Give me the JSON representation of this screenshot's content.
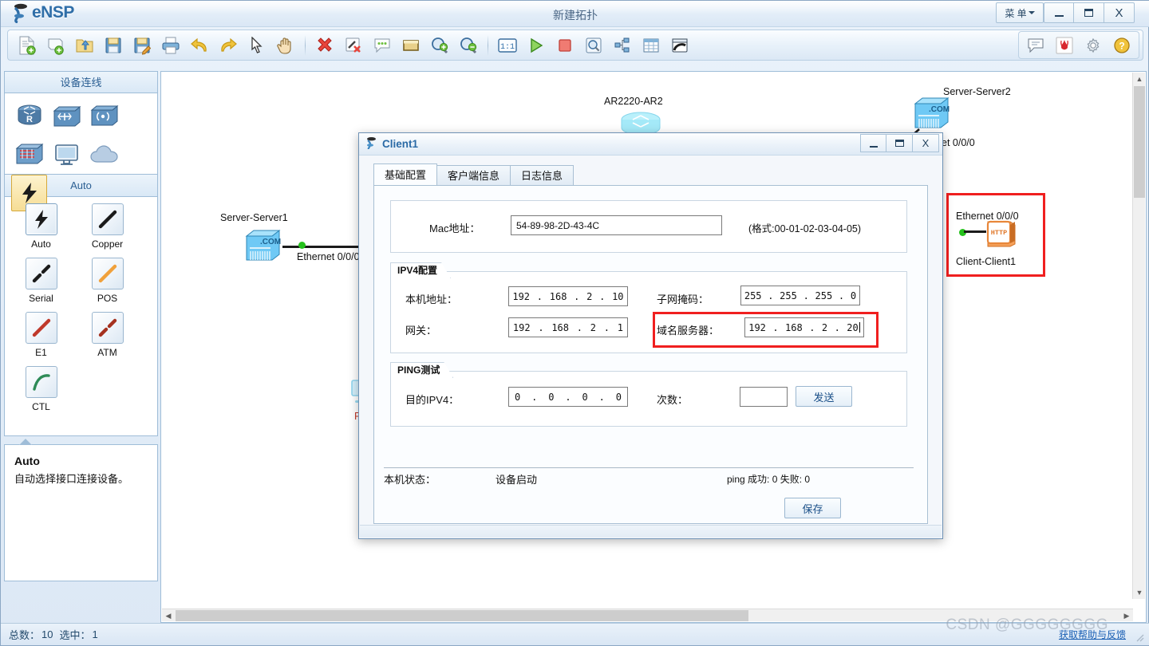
{
  "app": {
    "brand": "eNSP",
    "window_title": "新建拓扑",
    "menu_label": "菜 单",
    "window_buttons": {
      "minimize": "_",
      "maximize": "❐",
      "close": "X"
    }
  },
  "toolbar": {
    "left_icons": [
      {
        "name": "new-topology-icon",
        "title": "新建"
      },
      {
        "name": "new-device-icon",
        "title": "新建设备"
      },
      {
        "name": "open-folder-icon",
        "title": "打开"
      },
      {
        "name": "save-icon",
        "title": "保存"
      },
      {
        "name": "save-as-icon",
        "title": "另存为"
      },
      {
        "name": "print-icon",
        "title": "打印"
      },
      {
        "name": "undo-icon",
        "title": "撤销"
      },
      {
        "name": "redo-icon",
        "title": "恢复"
      },
      {
        "name": "pointer-icon",
        "title": "选择"
      },
      {
        "name": "hand-icon",
        "title": "拖动"
      },
      {
        "name": "delete-icon",
        "title": "删除"
      },
      {
        "name": "delete-link-icon",
        "title": "删除连线"
      },
      {
        "name": "comment-icon",
        "title": "添加描述"
      },
      {
        "name": "rectangle-icon",
        "title": "图形"
      },
      {
        "name": "zoom-in-icon",
        "title": "放大"
      },
      {
        "name": "zoom-out-icon",
        "title": "缩小"
      }
    ],
    "right_group_icons": [
      {
        "name": "one-to-one-icon",
        "title": "1:1"
      },
      {
        "name": "start-device-icon",
        "title": "开启设备"
      },
      {
        "name": "stop-device-icon",
        "title": "关闭设备"
      },
      {
        "name": "capture-packet-icon",
        "title": "数据抓包"
      },
      {
        "name": "topology-tree-icon",
        "title": "拓扑树"
      },
      {
        "name": "grid-icon",
        "title": "网格"
      },
      {
        "name": "console-icon",
        "title": "控制台"
      }
    ],
    "far_right_icons": [
      {
        "name": "feedback-icon",
        "title": "反馈"
      },
      {
        "name": "huawei-logo-icon",
        "title": "华为"
      },
      {
        "name": "settings-gear-icon",
        "title": "设置"
      },
      {
        "name": "help-icon",
        "title": "帮助"
      }
    ]
  },
  "sidebar": {
    "device_panel_title": "设备连线",
    "devices": [
      {
        "name": "router-device-icon",
        "label": "路由器",
        "selected": false
      },
      {
        "name": "switch-device-icon",
        "label": "交换机",
        "selected": false
      },
      {
        "name": "wlan-device-icon",
        "label": "无线局域网",
        "selected": false
      },
      {
        "name": "firewall-device-icon",
        "label": "防火墙",
        "selected": false
      },
      {
        "name": "terminal-device-icon",
        "label": "终端",
        "selected": false
      },
      {
        "name": "cloud-device-icon",
        "label": "其他设备",
        "selected": false
      },
      {
        "name": "connection-device-icon",
        "label": "设备连线",
        "selected": true
      }
    ],
    "lines_panel_title": "Auto",
    "lines": [
      {
        "label": "Auto",
        "icon": "auto-link-icon",
        "active": true
      },
      {
        "label": "Copper",
        "icon": "copper-link-icon",
        "active": false
      },
      {
        "label": "Serial",
        "icon": "serial-link-icon",
        "active": false
      },
      {
        "label": "POS",
        "icon": "pos-link-icon",
        "active": false
      },
      {
        "label": "E1",
        "icon": "e1-link-icon",
        "active": false
      },
      {
        "label": "ATM",
        "icon": "atm-link-icon",
        "active": false
      },
      {
        "label": "CTL",
        "icon": "ctl-link-icon",
        "active": false
      }
    ],
    "tip": {
      "title": "Auto",
      "body": "自动选择接口连接设备。"
    }
  },
  "canvas": {
    "nodes": [
      {
        "name": "node-server1",
        "label": "Server-Server1",
        "icon": "com-server-icon"
      },
      {
        "name": "node-ar2220",
        "label": "AR2220-AR2",
        "icon": "router-icon"
      },
      {
        "name": "node-server2",
        "label": "Server-Server2",
        "icon": "com-server-icon"
      },
      {
        "name": "node-client1",
        "label": "Client-Client1",
        "icon": "http-client-icon"
      }
    ],
    "interface_labels": [
      {
        "name": "iface-server1",
        "text": "Ethernet 0/0/0"
      },
      {
        "name": "iface-server2",
        "text": "et 0/0/0"
      },
      {
        "name": "iface-client1",
        "text": "Ethernet 0/0/0"
      }
    ],
    "highlight_color": "#f01f1f"
  },
  "statusbar": {
    "total_label": "总数：",
    "total_value": "10",
    "selected_label": "选中：",
    "selected_value": "1",
    "help_link": "获取帮助与反馈",
    "watermark": "CSDN @GGGGGGGG"
  },
  "dialog": {
    "title": "Client1",
    "icon": "client-window-icon",
    "buttons": {
      "minimize": "_",
      "maximize": "❐",
      "close": "X"
    },
    "tabs": [
      {
        "label": "基础配置",
        "active": true
      },
      {
        "label": "客户端信息",
        "active": false
      },
      {
        "label": "日志信息",
        "active": false
      }
    ],
    "mac": {
      "label": "Mac地址：",
      "value": "54-89-98-2D-43-4C",
      "hint": "(格式:00-01-02-03-04-05)"
    },
    "ipv4_group": {
      "caption": "IPV4配置",
      "local_address_label": "本机地址：",
      "local_address": [
        "192",
        "168",
        "2",
        "10"
      ],
      "subnet_mask_label": "子网掩码：",
      "subnet_mask": [
        "255",
        "255",
        "255",
        "0"
      ],
      "gateway_label": "网关：",
      "gateway": [
        "192",
        "168",
        "2",
        "1"
      ],
      "dns_label": "域名服务器：",
      "dns": [
        "192",
        "168",
        "2",
        "20"
      ]
    },
    "ping_group": {
      "caption": "PING测试",
      "dest_label": "目的IPV4：",
      "dest": [
        "0",
        "0",
        "0",
        "0"
      ],
      "count_label": "次数：",
      "count_value": "",
      "send_button": "发送"
    },
    "status": {
      "local_status_label": "本机状态：",
      "local_status_value": "设备启动",
      "ping_result": "ping 成功: 0 失败: 0"
    },
    "save_button": "保存"
  }
}
